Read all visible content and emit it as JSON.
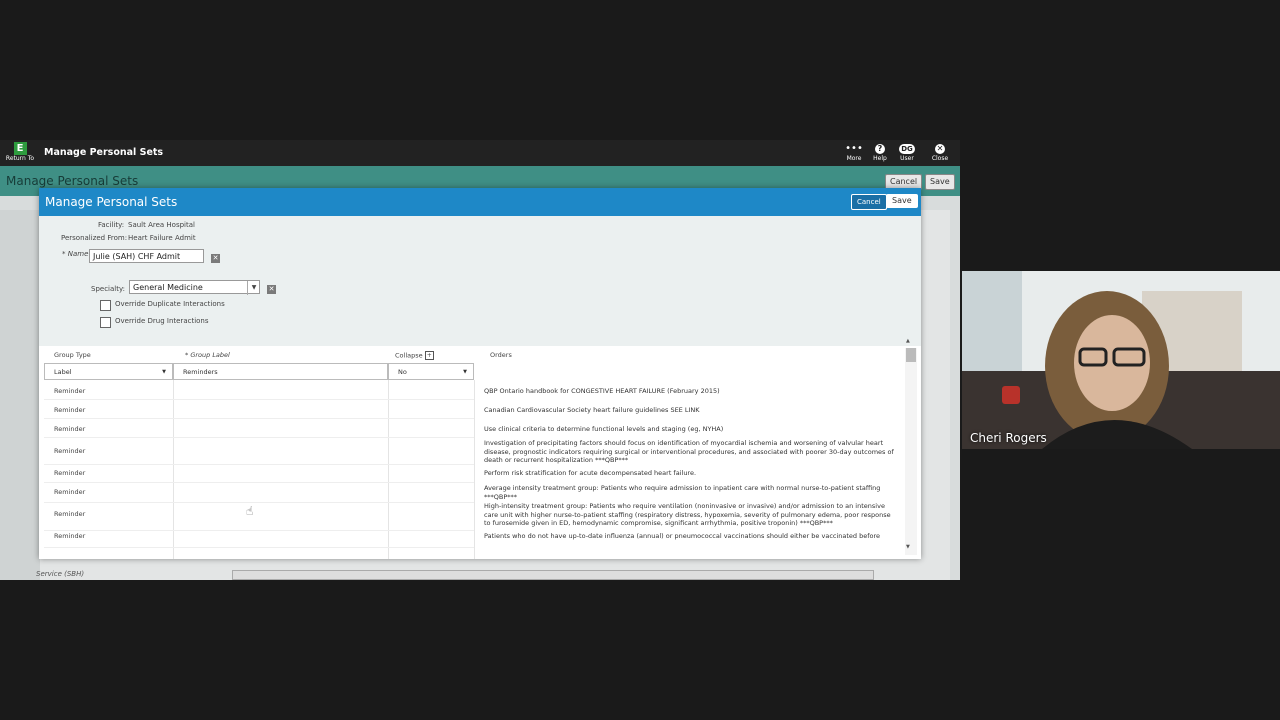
{
  "app": {
    "return_label": "Return To",
    "logo_letter": "E",
    "title": "Manage Personal Sets",
    "toolbar": {
      "more_label": "More",
      "help_label": "Help",
      "user_initials": "DG",
      "user_label": "User",
      "close_label": "Close"
    },
    "subbar": {
      "title": "Manage Personal Sets",
      "cancel_label": "Cancel",
      "save_label": "Save"
    },
    "background": {
      "service_label": "Service (SBH)"
    }
  },
  "modal": {
    "title": "Manage Personal Sets",
    "cancel_label": "Cancel",
    "save_label": "Save",
    "facility_label": "Facility:",
    "facility_value": "Sault Area Hospital",
    "personalized_label": "Personalized From:",
    "personalized_value": "Heart Failure Admit",
    "name_label": "* Name",
    "name_value": "Julie (SAH) CHF Admit",
    "specialty_label": "Specialty:",
    "specialty_value": "General Medicine",
    "override_duplicate_label": "Override Duplicate Interactions",
    "override_drug_label": "Override Drug Interactions",
    "grid": {
      "headers": {
        "group_type": "Group Type",
        "group_label": "* Group Label",
        "collapse": "Collapse",
        "orders": "Orders"
      },
      "first_row": {
        "group_type": "Label",
        "group_label": "Reminders",
        "collapse": "No"
      },
      "rows": [
        {
          "type": "Reminder",
          "order": "QBP Ontario handbook for CONGESTIVE HEART FAILURE (February 2015)"
        },
        {
          "type": "Reminder",
          "order": "Canadian Cardiovascular Society heart failure guidelines SEE LINK"
        },
        {
          "type": "Reminder",
          "order": "Use clinical criteria to determine functional levels and staging (eg, NYHA)"
        },
        {
          "type": "Reminder",
          "order": "Investigation of precipitating factors should focus on identification of myocardial ischemia and worsening of valvular heart disease, prognostic indicators requiring surgical or interventional procedures, and associated with poorer 30-day outcomes of death or recurrent hospitalization ***QBP***"
        },
        {
          "type": "Reminder",
          "order": "Perform risk stratification for acute decompensated heart failure."
        },
        {
          "type": "Reminder",
          "order": "Average intensity treatment group: Patients who require admission to inpatient care with normal nurse-to-patient staffing ***QBP***"
        },
        {
          "type": "Reminder",
          "order": "High-intensity treatment group: Patients who require ventilation (noninvasive or invasive) and/or admission to an intensive care unit with higher nurse-to-patient staffing (respiratory distress, hypoxemia, severity of pulmonary edema, poor response to furosemide given in ED, hemodynamic compromise, significant arrhythmia, positive troponin) ***QBP***"
        },
        {
          "type": "Reminder",
          "order": "Patients who do not have up-to-date influenza (annual) or pneumococcal vaccinations should either be vaccinated before"
        }
      ]
    }
  },
  "video": {
    "participant_name": "Cheri Rogers"
  }
}
